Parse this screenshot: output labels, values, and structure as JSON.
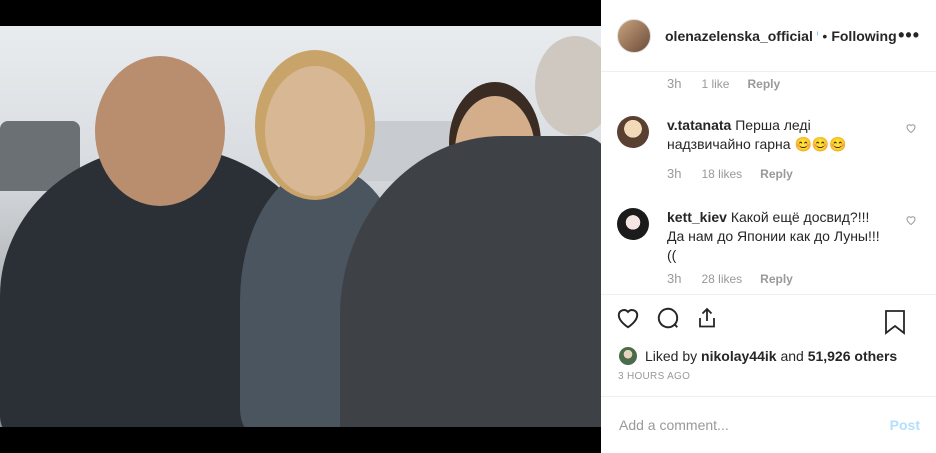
{
  "header": {
    "username": "olenazelenska_official",
    "verified_mark": "ᶦ",
    "separator": "•",
    "follow_label": "Following",
    "more_label": "•••"
  },
  "comments": [
    {
      "username": "",
      "text": "",
      "time": "3h",
      "likes": "1 like",
      "reply": "Reply"
    },
    {
      "username": "v.tatanata",
      "text": "Перша леді надзвичайно гарна 😊😊😊",
      "time": "3h",
      "likes": "18 likes",
      "reply": "Reply"
    },
    {
      "username": "kett_kiev",
      "text": "Какой ещё досвид?!!! Да нам до Японии как до Луны!!! ((",
      "time": "3h",
      "likes": "28 likes",
      "reply": "Reply"
    }
  ],
  "liked_by": {
    "prefix": "Liked by",
    "user": "nikolay44ik",
    "conj": "and",
    "others": "51,926 others"
  },
  "posted_ago": "3 HOURS AGO",
  "add_comment": {
    "placeholder": "Add a comment...",
    "post_label": "Post"
  },
  "colors": {
    "link_blue": "#3897f0",
    "post_disabled": "#b2dffc",
    "muted": "#999999",
    "text": "#262626"
  }
}
